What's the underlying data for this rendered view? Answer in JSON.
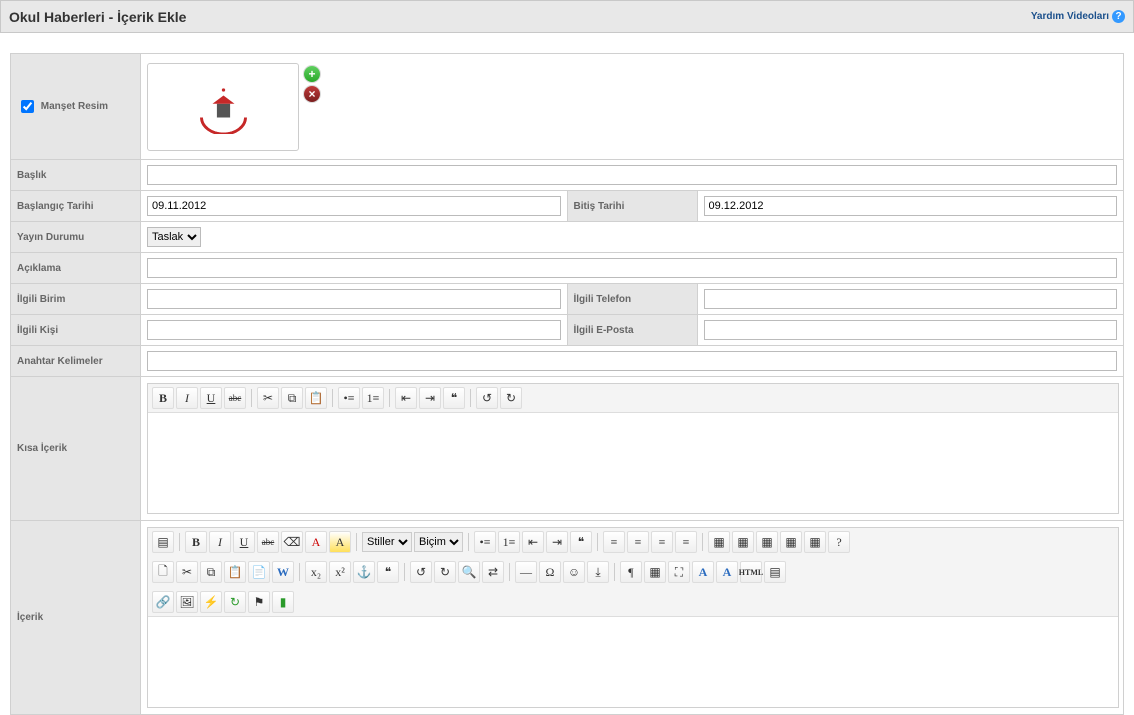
{
  "header": {
    "title": "Okul Haberleri - İçerik Ekle",
    "help_label": "Yardım Videoları"
  },
  "labels": {
    "manset_resim": "Manşet Resim",
    "baslik": "Başlık",
    "baslangic_tarihi": "Başlangıç Tarihi",
    "bitis_tarihi": "Bitiş Tarihi",
    "yayin_durumu": "Yayın Durumu",
    "aciklama": "Açıklama",
    "ilgili_birim": "İlgili Birim",
    "ilgili_telefon": "İlgili Telefon",
    "ilgili_kisi": "İlgili Kişi",
    "ilgili_eposta": "İlgili E-Posta",
    "anahtar_kelimeler": "Anahtar Kelimeler",
    "kisa_icerik": "Kısa İçerik",
    "icerik": "İçerik"
  },
  "values": {
    "baslik": "",
    "baslangic_tarihi": "09.11.2012",
    "bitis_tarihi": "09.12.2012",
    "yayin_durumu": "Taslak",
    "aciklama": "",
    "ilgili_birim": "",
    "ilgili_telefon": "",
    "ilgili_kisi": "",
    "ilgili_eposta": "",
    "anahtar_kelimeler": ""
  },
  "image_actions": {
    "add": "+",
    "remove": "×"
  },
  "mini_editor_icons": {
    "bold": "B",
    "italic": "I",
    "underline": "U",
    "strike": "abc",
    "cut": "✂",
    "copy": "⧉",
    "paste": "📋",
    "ul": "•≡",
    "ol": "1≡",
    "outdent": "⇤",
    "indent": "⇥",
    "quote": "❝",
    "undo": "↺",
    "redo": "↻"
  },
  "full_editor_selects": {
    "styles": "Stiller",
    "format": "Biçim"
  },
  "full_editor_icons_row1": [
    "source",
    "bold",
    "italic",
    "underline",
    "strike",
    "removefmt",
    "color",
    "bgcolor",
    "stylesel",
    "formatsel",
    "ul",
    "ol",
    "outdent",
    "indent",
    "block",
    "align-left",
    "align-center",
    "align-right",
    "align-justify",
    "group-a",
    "group-b",
    "group-c",
    "group-d",
    "group-e",
    "help"
  ],
  "full_editor_icons_row2": [
    "new",
    "cut",
    "copy",
    "paste",
    "paste-text",
    "paste-word",
    "sep",
    "smallcaps",
    "caps",
    "sup",
    "sub",
    "sep",
    "undo",
    "redo",
    "find",
    "replace",
    "anchor",
    "image",
    "media",
    "sep",
    "hr",
    "omega",
    "smiley",
    "pagebreak",
    "sep",
    "para",
    "table",
    "fit",
    "source-html",
    "css"
  ],
  "full_editor_icons_row3": [
    "link",
    "image-manager",
    "flash",
    "refresh",
    "anchor2",
    "layers"
  ]
}
